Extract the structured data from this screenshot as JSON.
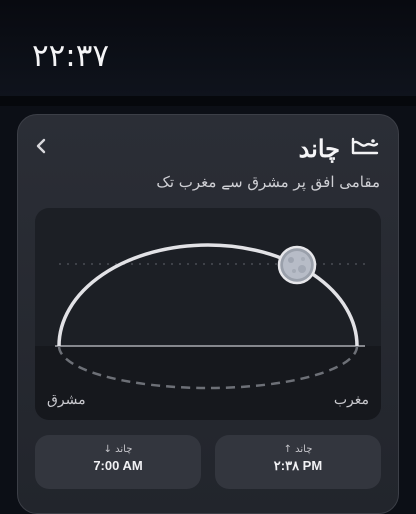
{
  "status_bar": {
    "time": "۲۲:۳۷"
  },
  "card": {
    "back_icon": "chevron-left-icon",
    "title_icon": "moon-horizon-icon",
    "title": "چاند",
    "subtitle": "مقامی افق پر مشرق سے مغرب تک",
    "chart": {
      "east_label": "مشرق",
      "west_label": "مغرب",
      "moon_position_fraction": 0.73
    },
    "moonset": {
      "label": "چاند ↓",
      "time": "7:00 AM"
    },
    "moonrise": {
      "label": "چاند ↑",
      "time": "۲:۳۸ PM"
    }
  }
}
